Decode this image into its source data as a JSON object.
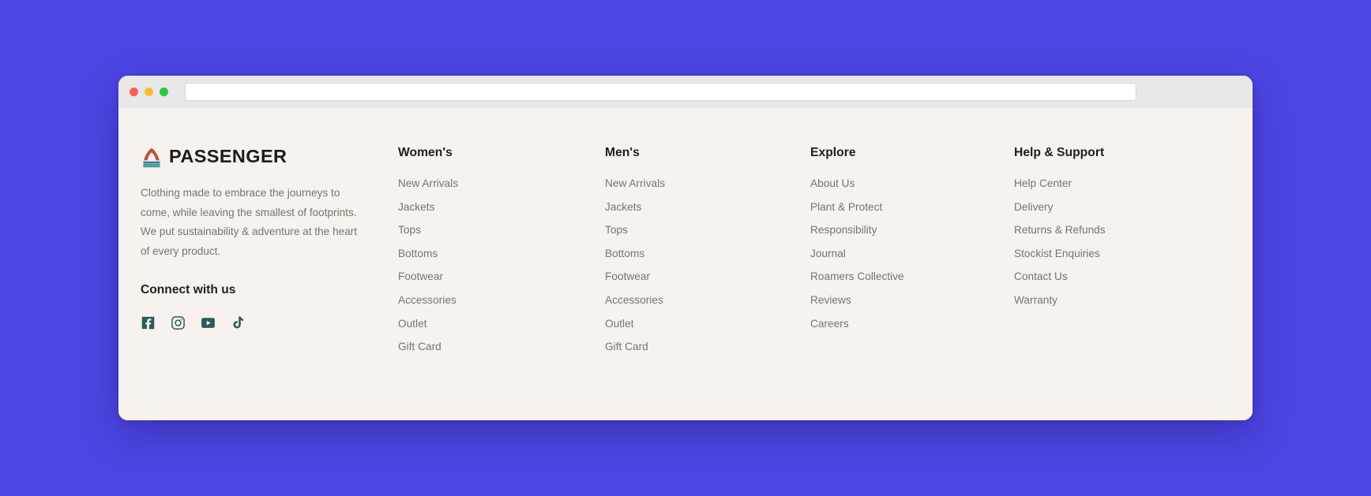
{
  "page": {
    "background_color": "#4d45e3",
    "footer_background_color": "#f7f2ed",
    "heading_color": "#1f1f1f",
    "link_color": "#7a736d",
    "social_icon_color": "#2b5d58"
  },
  "browser": {
    "url_value": "",
    "url_placeholder": "",
    "traffic_lights": [
      {
        "name": "close",
        "color": "#fc5f57"
      },
      {
        "name": "minimize",
        "color": "#fdbc2e"
      },
      {
        "name": "maximize",
        "color": "#28c840"
      }
    ]
  },
  "footer": {
    "brand": {
      "logo_icon": "passenger-arch-logo-icon",
      "logo_colors": {
        "arch": "#c0503c",
        "stripe_blue": "#2a6ca8",
        "stripe_teal": "#1f8476"
      },
      "wordmark": "PASSENGER",
      "description": "Clothing made to embrace the journeys to come, while leaving the smallest of footprints. We put sustainability & adventure at the heart of every product.",
      "connect_title": "Connect with us",
      "social": [
        {
          "icon": "facebook-icon",
          "label": "Facebook"
        },
        {
          "icon": "instagram-icon",
          "label": "Instagram"
        },
        {
          "icon": "youtube-icon",
          "label": "YouTube"
        },
        {
          "icon": "tiktok-icon",
          "label": "TikTok"
        }
      ]
    },
    "columns": [
      {
        "id": "womens",
        "heading": "Women's",
        "links": [
          "New Arrivals",
          "Jackets",
          "Tops",
          "Bottoms",
          "Footwear",
          "Accessories",
          "Outlet",
          "Gift Card"
        ]
      },
      {
        "id": "mens",
        "heading": "Men's",
        "links": [
          "New Arrivals",
          "Jackets",
          "Tops",
          "Bottoms",
          "Footwear",
          "Accessories",
          "Outlet",
          "Gift Card"
        ]
      },
      {
        "id": "explore",
        "heading": "Explore",
        "links": [
          "About Us",
          "Plant & Protect",
          "Responsibility",
          "Journal",
          "Roamers Collective",
          "Reviews",
          "Careers"
        ]
      },
      {
        "id": "help-support",
        "heading": "Help & Support",
        "links": [
          "Help Center",
          "Delivery",
          "Returns & Refunds",
          "Stockist Enquiries",
          "Contact Us",
          "Warranty"
        ]
      }
    ]
  }
}
